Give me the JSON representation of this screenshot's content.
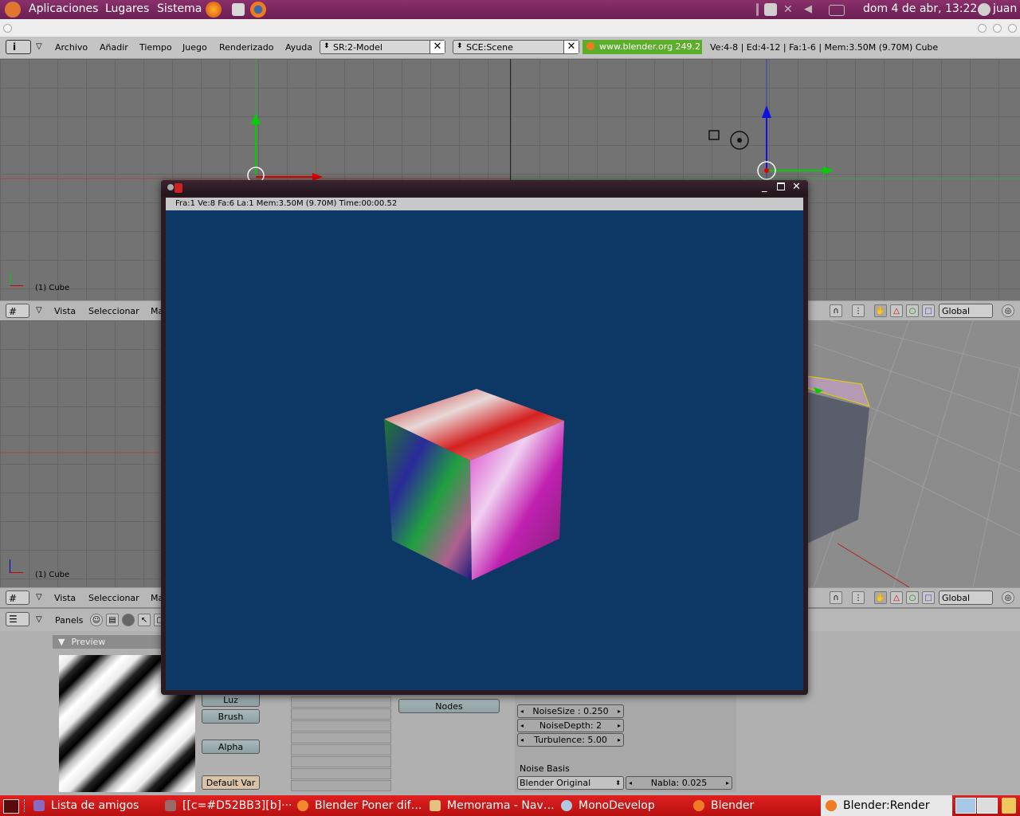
{
  "top_panel": {
    "menus": [
      "Aplicaciones",
      "Lugares",
      "Sistema"
    ],
    "clock": "dom  4 de abr, 13:22",
    "user": "juan"
  },
  "info_header": {
    "menus": [
      "Archivo",
      "Añadir",
      "Tiempo",
      "Juego",
      "Renderizado",
      "Ayuda"
    ],
    "screen_field": "SR:2-Model",
    "scene_field": "SCE:Scene",
    "version_link": "www.blender.org 249.2",
    "stats": "Ve:4-8 | Ed:4-12 | Fa:1-6 | Mem:3.50M (9.70M) Cube"
  },
  "viewport_top": {
    "object_label": "(1) Cube",
    "header": {
      "vista": "Vista",
      "seleccionar": "Seleccionar",
      "ma": "Ma",
      "orientation": "Global"
    }
  },
  "viewport_bottom": {
    "object_label": "(1) Cube",
    "header": {
      "vista": "Vista",
      "seleccionar": "Seleccionar",
      "ma": "Ma",
      "orientation": "Global"
    }
  },
  "buttons_window": {
    "panels_label": "Panels",
    "preview_title": "Preview",
    "buttons": [
      "Luz",
      "Brush",
      "Alpha",
      "Default Var"
    ],
    "nodes_label": "Nodes",
    "fields": {
      "noise_size": "NoiseSize : 0.250",
      "noise_depth": "NoiseDepth: 2",
      "turbulence": "Turbulence: 5.00",
      "noise_basis_label": "Noise Basis",
      "noise_basis_value": "Blender Original",
      "nabla": "Nabla: 0.025"
    }
  },
  "render_window": {
    "stats": "Fra:1  Ve:8 Fa:6 La:1  Mem:3.50M (9.70M) Time:00:00.52",
    "background_color": "#0d3764"
  },
  "taskbar": {
    "tasks": [
      "Lista de amigos",
      "[[c=#D52BB3][b]···",
      "Blender Poner dif…",
      "Memorama - Nav…",
      "MonoDevelop",
      "Blender",
      "Blender:Render"
    ]
  },
  "colors": {
    "panel_purple": "#7a2660",
    "taskbar_red": "#c81414",
    "version_green": "#5cae2a"
  }
}
